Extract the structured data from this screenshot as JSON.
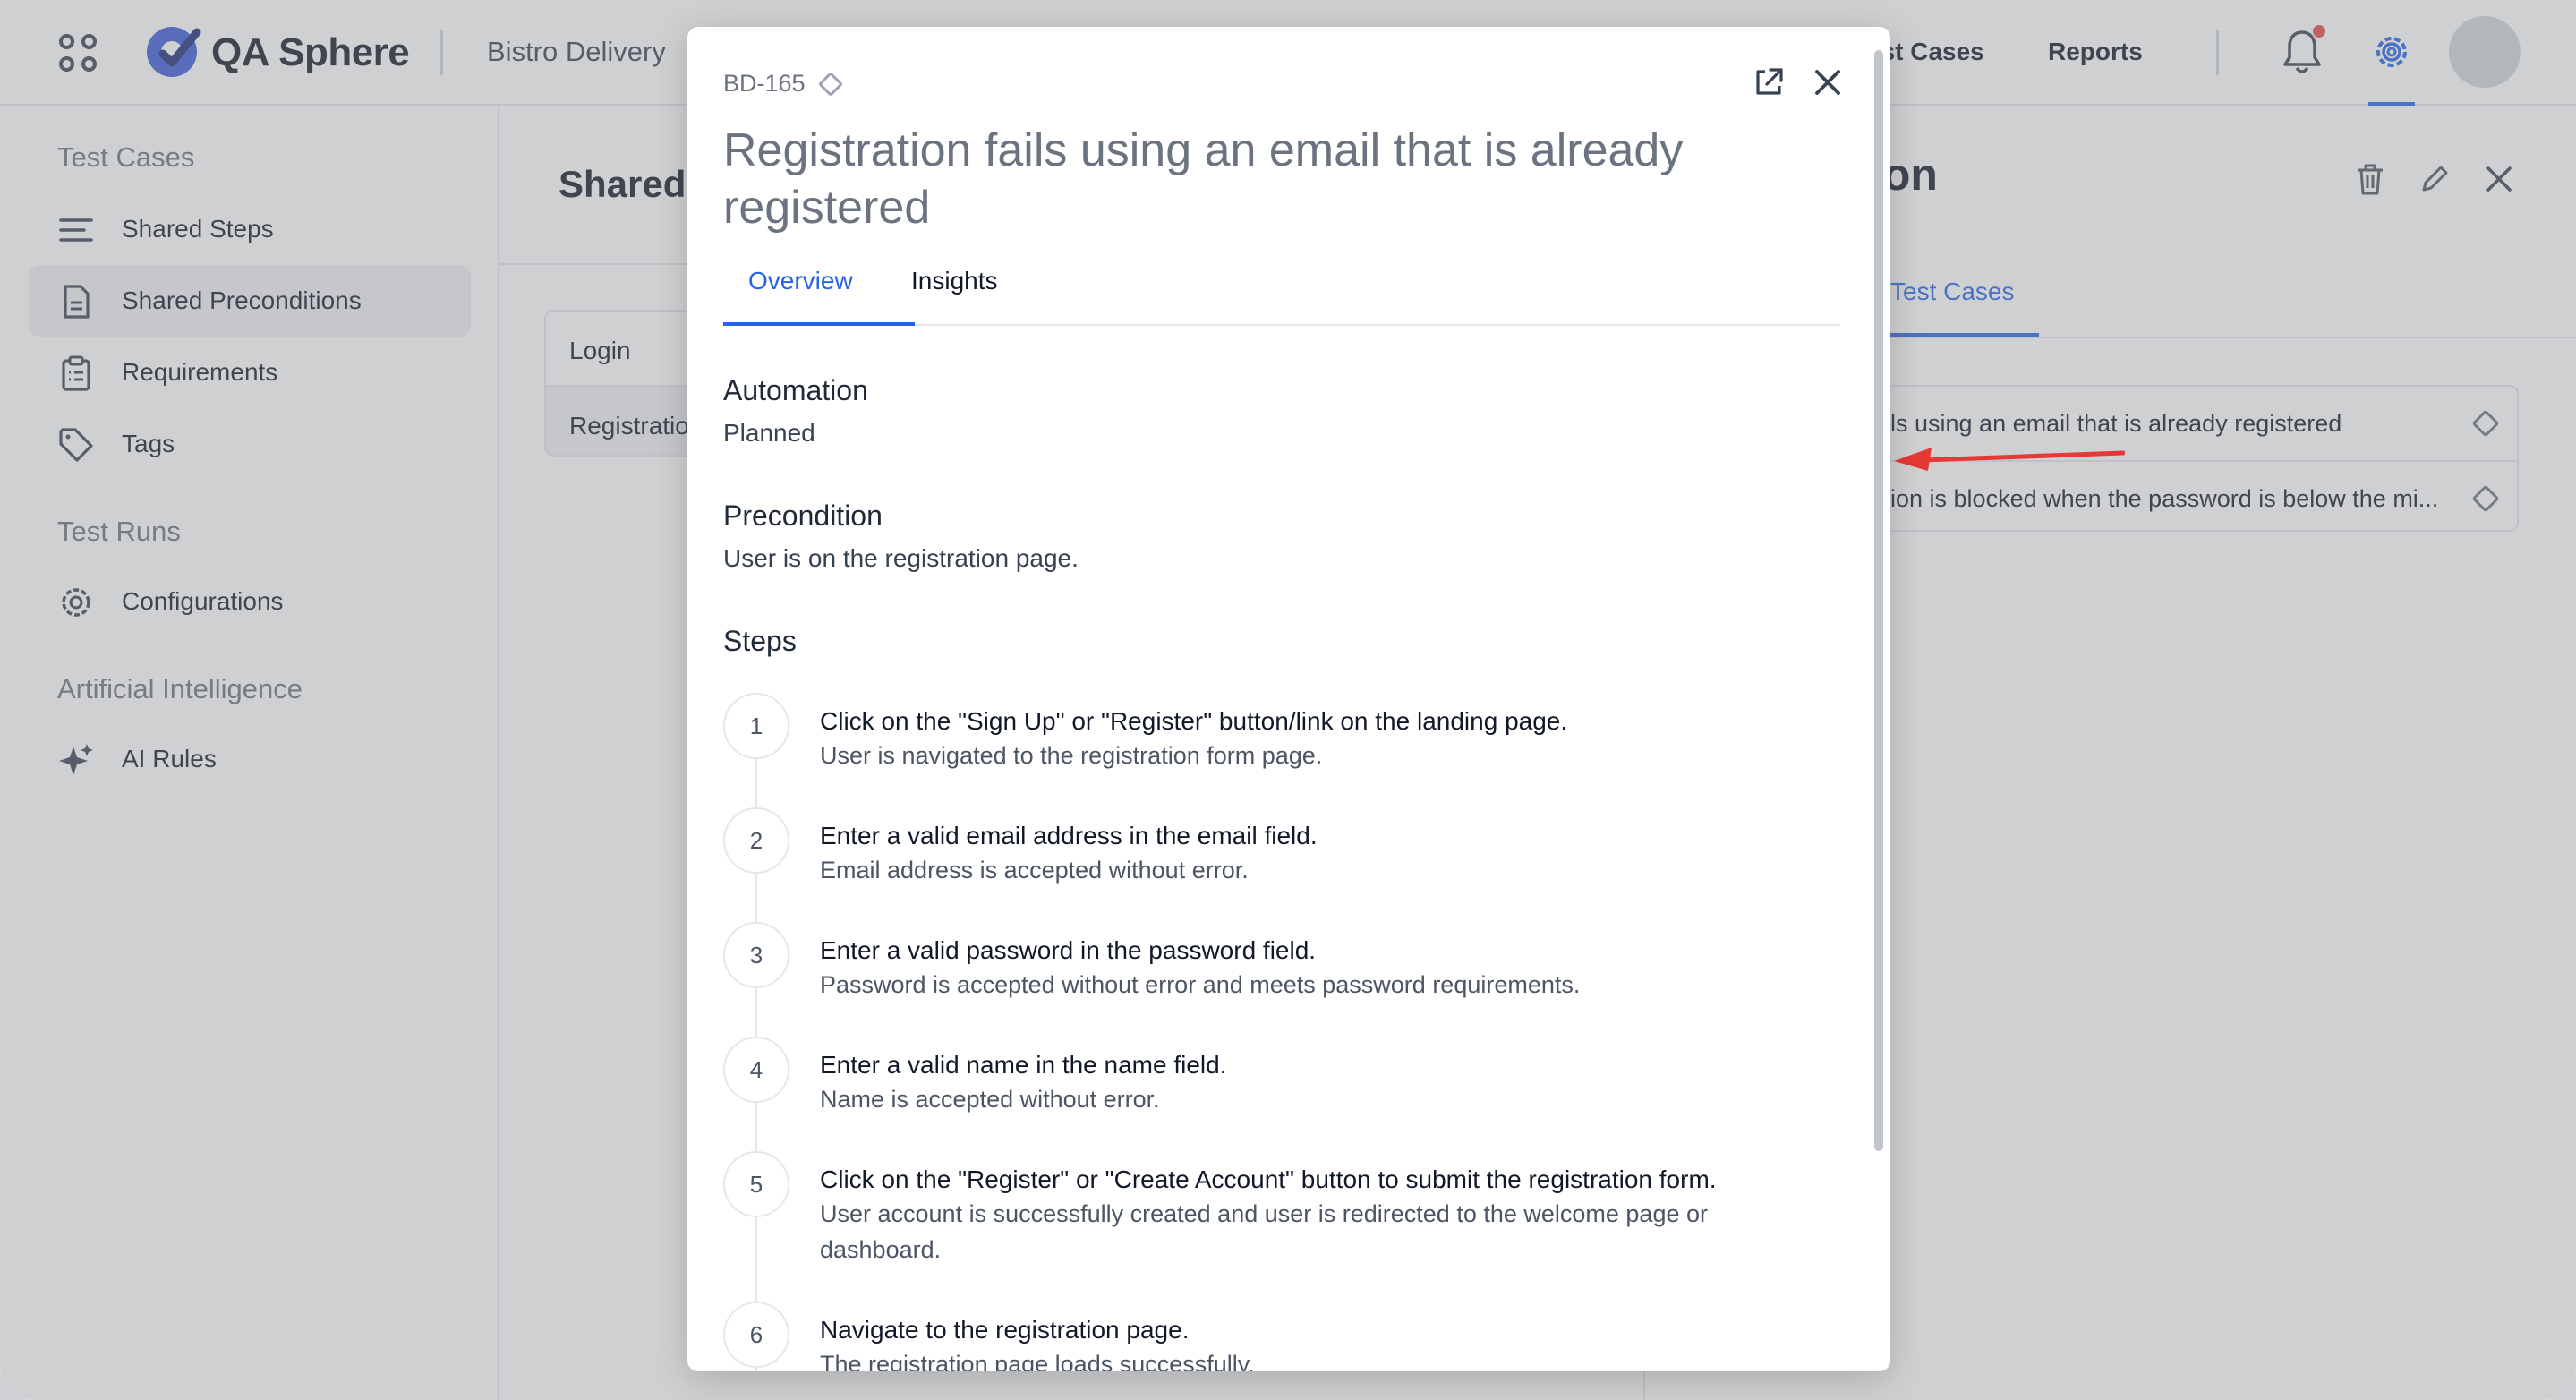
{
  "header": {
    "logo_text": "QA Sphere",
    "project": "Bistro Delivery",
    "nav": [
      "est Cases",
      "Reports"
    ]
  },
  "sidebar": {
    "groups": [
      "Test Cases",
      "Test Runs",
      "Artificial Intelligence"
    ],
    "items": [
      "Shared Steps",
      "Shared Preconditions",
      "Requirements",
      "Tags",
      "Configurations",
      "AI Rules"
    ]
  },
  "middle": {
    "title": "Shared",
    "rows": [
      "Login",
      "Registration"
    ]
  },
  "right_panel": {
    "title": "ion",
    "tab": "Test Cases",
    "rows": [
      "ls using an email that is already registered",
      "ion is blocked when the password is below the mi..."
    ]
  },
  "modal": {
    "id": "BD-165",
    "title": "Registration fails using an email that is already registered",
    "tabs": [
      "Overview",
      "Insights"
    ],
    "automation_label": "Automation",
    "automation_value": "Planned",
    "precondition_label": "Precondition",
    "precondition_value": "User is on the registration page.",
    "steps_label": "Steps",
    "steps": [
      {
        "num": "1",
        "action": "Click on the \"Sign Up\" or \"Register\" button/link on the landing page.",
        "expected": "User is navigated to the registration form page."
      },
      {
        "num": "2",
        "action": "Enter a valid email address in the email field.",
        "expected": "Email address is accepted without error."
      },
      {
        "num": "3",
        "action": "Enter a valid password in the password field.",
        "expected": "Password is accepted without error and meets password requirements."
      },
      {
        "num": "4",
        "action": "Enter a valid name in the name field.",
        "expected": "Name is accepted without error."
      },
      {
        "num": "5",
        "action": "Click on the \"Register\" or \"Create Account\" button to submit the registration form.",
        "expected": "User account is successfully created and user is redirected to the welcome page or dashboard."
      },
      {
        "num": "6",
        "action": "Navigate to the registration page.",
        "expected": "The registration page loads successfully."
      }
    ]
  },
  "colors": {
    "accent": "#2563eb",
    "notification": "#e5484d",
    "annotation_arrow": "#e53935"
  }
}
